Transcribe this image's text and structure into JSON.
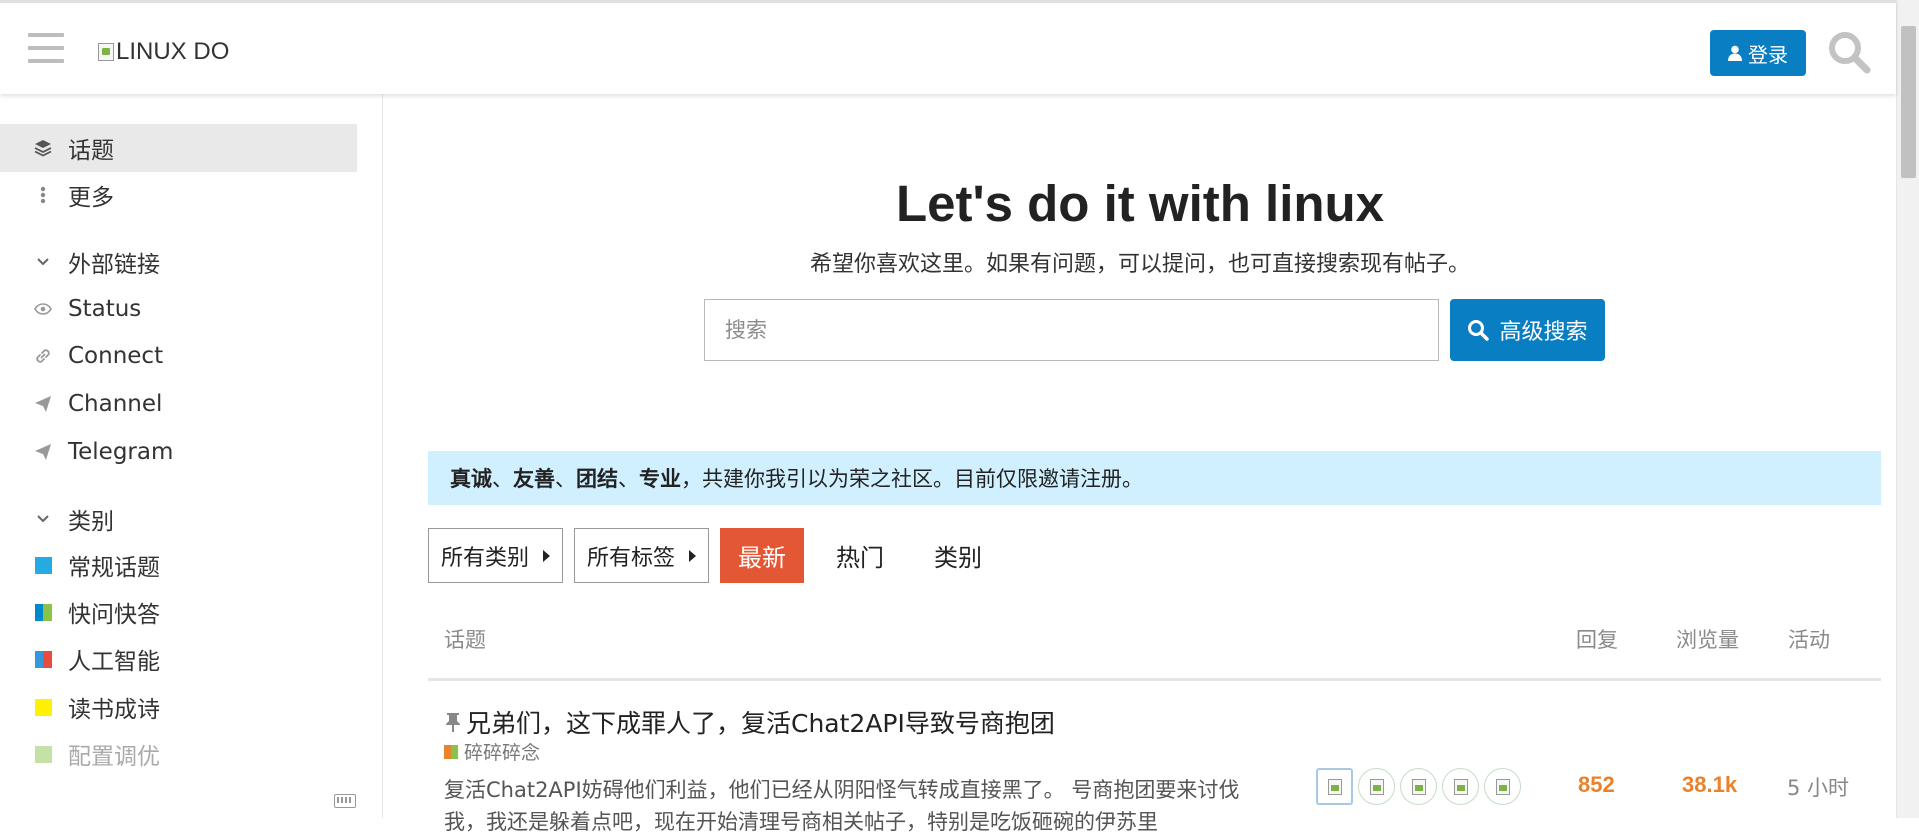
{
  "header": {
    "logo_text": "LINUX DO",
    "login_label": "登录"
  },
  "sidebar": {
    "items": [
      {
        "label": "话题",
        "active": true
      },
      {
        "label": "更多"
      }
    ],
    "external_links_heading": "外部链接",
    "external_links": [
      "Status",
      "Connect",
      "Channel",
      "Telegram"
    ],
    "categories_heading": "类别",
    "categories": [
      {
        "label": "常规话题",
        "colors": [
          "#25aae2"
        ]
      },
      {
        "label": "快问快答",
        "colors": [
          "#0088cc",
          "#8bc34a"
        ]
      },
      {
        "label": "人工智能",
        "colors": [
          "#3498db",
          "#e74c3c"
        ]
      },
      {
        "label": "读书成诗",
        "colors": [
          "#fff200"
        ]
      },
      {
        "label": "配置调优",
        "colors": [
          "#9ccc65"
        ]
      }
    ]
  },
  "hero": {
    "title": "Let's do it with linux",
    "subtitle": "希望你喜欢这里。如果有问题，可以提问，也可直接搜索现有帖子。",
    "search_placeholder": "搜索",
    "advanced_search_label": "高级搜索"
  },
  "banner": {
    "w1": "真诚",
    "sep1": "、",
    "w2": "友善",
    "sep2": "、",
    "w3": "团结",
    "sep3": "、",
    "w4": "专业",
    "rest": "，共建你我引以为荣之社区。目前仅限邀请注册。"
  },
  "nav": {
    "all_categories": "所有类别",
    "all_tags": "所有标签",
    "tabs": [
      "最新",
      "热门",
      "类别"
    ]
  },
  "table": {
    "col_topic": "话题",
    "col_replies": "回复",
    "col_views": "浏览量",
    "col_activity": "活动"
  },
  "topics": [
    {
      "title": "兄弟们，这下成罪人了，复活Chat2API导致号商抱团",
      "category": "碎碎碎念",
      "category_colors": [
        "#e9822c",
        "#8bc34a"
      ],
      "excerpt": "复活Chat2API妨碍他们利益，他们已经从阴阳怪气转成直接黑了。 号商抱团要来讨伐我，我还是躲着点吧，现在开始清理号商相关帖子，特别是吃饭砸碗的伊苏里",
      "replies": "852",
      "views": "38.1k",
      "activity": "5 小时"
    }
  ],
  "colors": {
    "accent": "#0a7ec2",
    "active_tab": "#e45735",
    "banner_bg": "#d1f0ff",
    "stat": "#e9822c"
  }
}
